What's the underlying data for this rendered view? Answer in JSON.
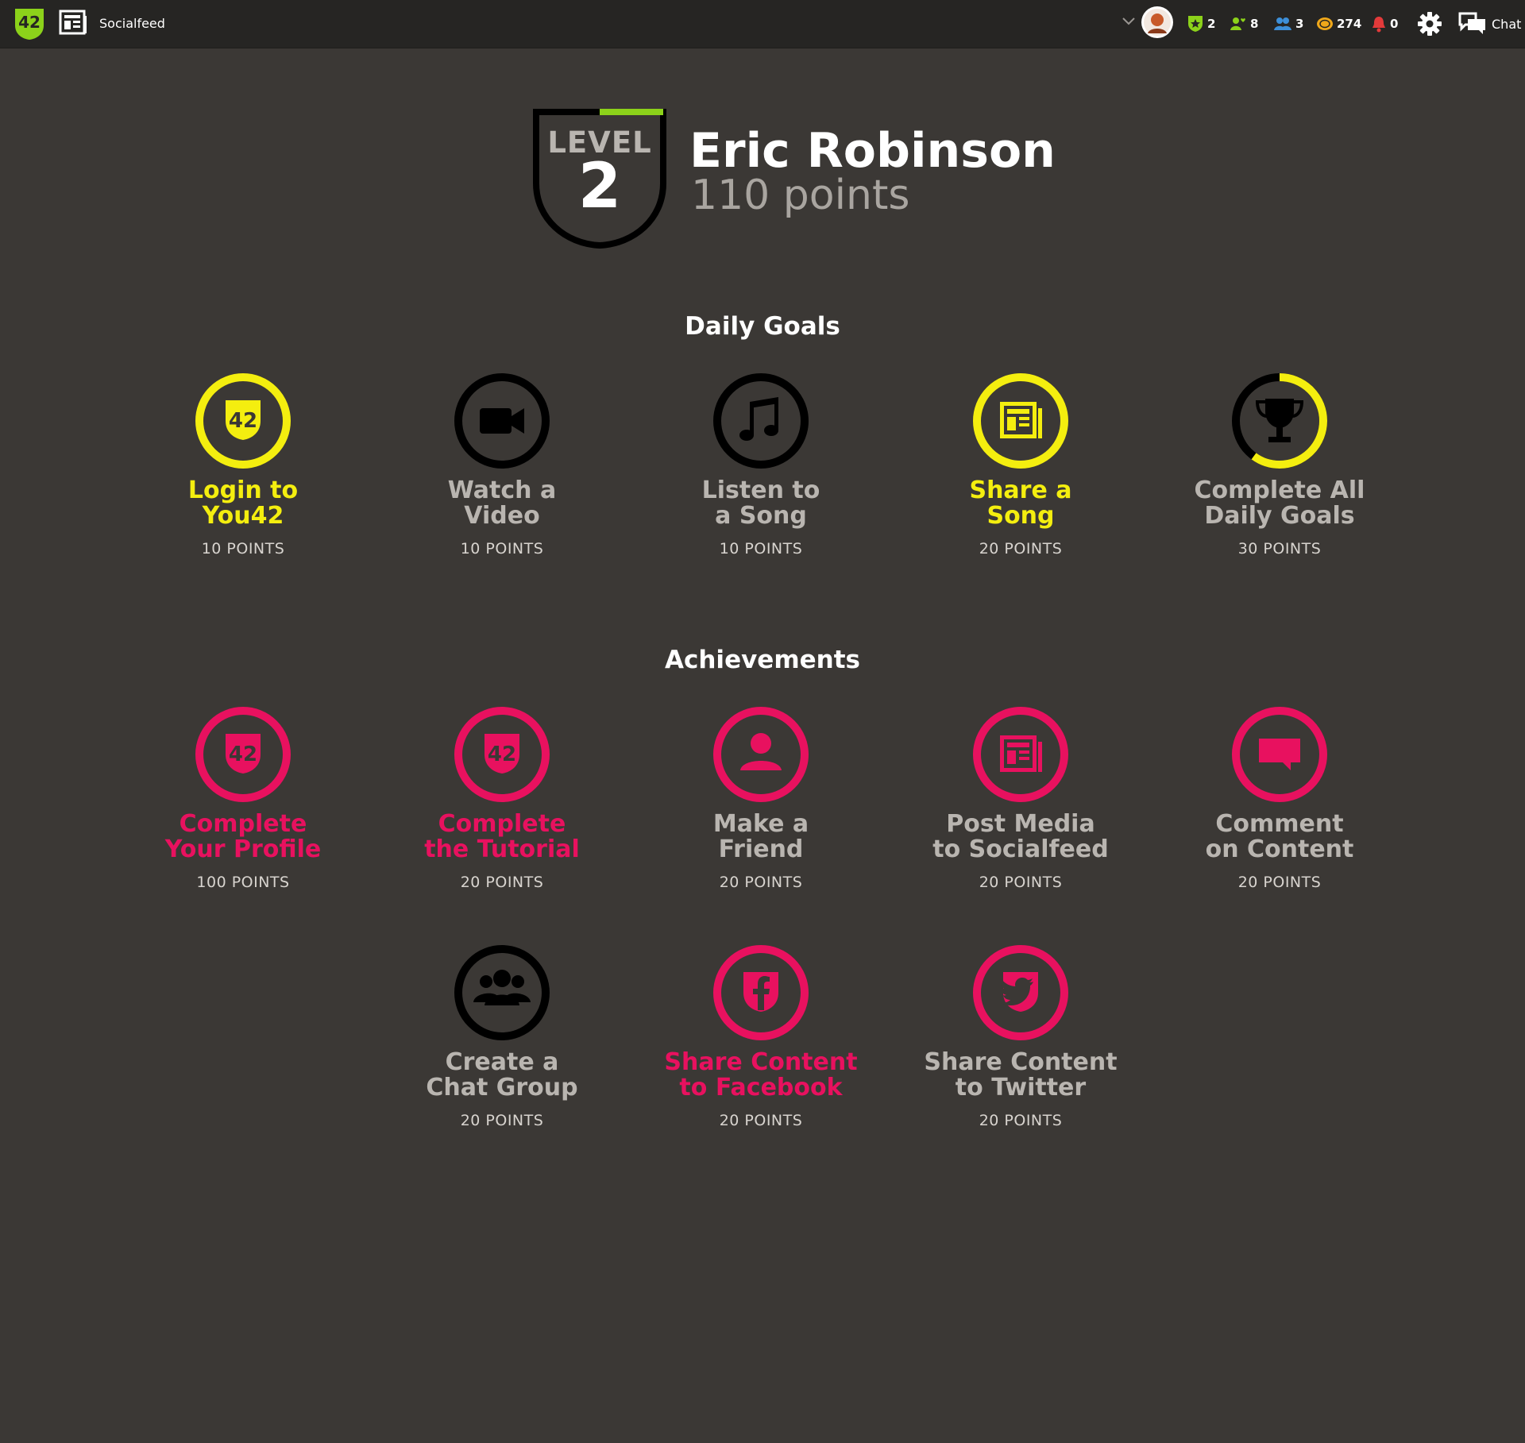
{
  "topbar": {
    "feed_label": "Socialfeed",
    "stats": [
      {
        "icon": "shield-star-icon",
        "value": "2",
        "color": "#8cd21a"
      },
      {
        "icon": "friend-heart-icon",
        "value": "8",
        "color": "#8cd21a"
      },
      {
        "icon": "group-icon",
        "value": "3",
        "color": "#3d8fd8"
      },
      {
        "icon": "coin-icon",
        "value": "274",
        "color": "#f0a81a"
      },
      {
        "icon": "bell-icon",
        "value": "0",
        "color": "#e33a3a"
      }
    ],
    "chat_label": "Chat"
  },
  "profile": {
    "level_word": "LEVEL",
    "level_number": "2",
    "level_progress": 0.5,
    "name": "Eric Robinson",
    "points": "110 points"
  },
  "daily_goals": {
    "title": "Daily Goals",
    "items": [
      {
        "icon": "you42-icon",
        "title_line1": "Login to",
        "title_line2": "You42",
        "points": "10 POINTS",
        "state": "complete",
        "color": "#f4ee0f"
      },
      {
        "icon": "video-camera-icon",
        "title_line1": "Watch a",
        "title_line2": "Video",
        "points": "10 POINTS",
        "state": "incomplete",
        "color": "#000000"
      },
      {
        "icon": "music-note-icon",
        "title_line1": "Listen to",
        "title_line2": "a Song",
        "points": "10 POINTS",
        "state": "incomplete",
        "color": "#000000"
      },
      {
        "icon": "newspaper-icon",
        "title_line1": "Share a",
        "title_line2": "Song",
        "points": "20 POINTS",
        "state": "complete",
        "color": "#f4ee0f"
      },
      {
        "icon": "trophy-icon",
        "title_line1": "Complete All",
        "title_line2": "Daily Goals",
        "points": "30 POINTS",
        "state": "partial",
        "progress": 0.6,
        "color": "#f4ee0f"
      }
    ]
  },
  "achievements": {
    "title": "Achievements",
    "items": [
      {
        "icon": "you42-icon",
        "title_line1": "Complete",
        "title_line2": "Your Profile",
        "points": "100 POINTS",
        "state": "complete",
        "color": "#e8115f"
      },
      {
        "icon": "you42-icon",
        "title_line1": "Complete",
        "title_line2": "the Tutorial",
        "points": "20 POINTS",
        "state": "complete",
        "color": "#e8115f"
      },
      {
        "icon": "user-icon",
        "title_line1": "Make a",
        "title_line2": "Friend",
        "points": "20 POINTS",
        "state": "incomplete",
        "color": "#e8115f"
      },
      {
        "icon": "newspaper-icon",
        "title_line1": "Post Media",
        "title_line2": "to Socialfeed",
        "points": "20 POINTS",
        "state": "incomplete",
        "color": "#e8115f"
      },
      {
        "icon": "speech-bubble-icon",
        "title_line1": "Comment",
        "title_line2": "on Content",
        "points": "20 POINTS",
        "state": "incomplete",
        "color": "#e8115f"
      },
      {
        "icon": "group-icon",
        "title_line1": "Create a",
        "title_line2": "Chat Group",
        "points": "20 POINTS",
        "state": "incomplete",
        "color": "#000000"
      },
      {
        "icon": "facebook-icon",
        "title_line1": "Share Content",
        "title_line2": "to Facebook",
        "points": "20 POINTS",
        "state": "complete",
        "color": "#e8115f"
      },
      {
        "icon": "twitter-icon",
        "title_line1": "Share Content",
        "title_line2": "to Twitter",
        "points": "20 POINTS",
        "state": "incomplete",
        "color": "#e8115f"
      }
    ]
  }
}
